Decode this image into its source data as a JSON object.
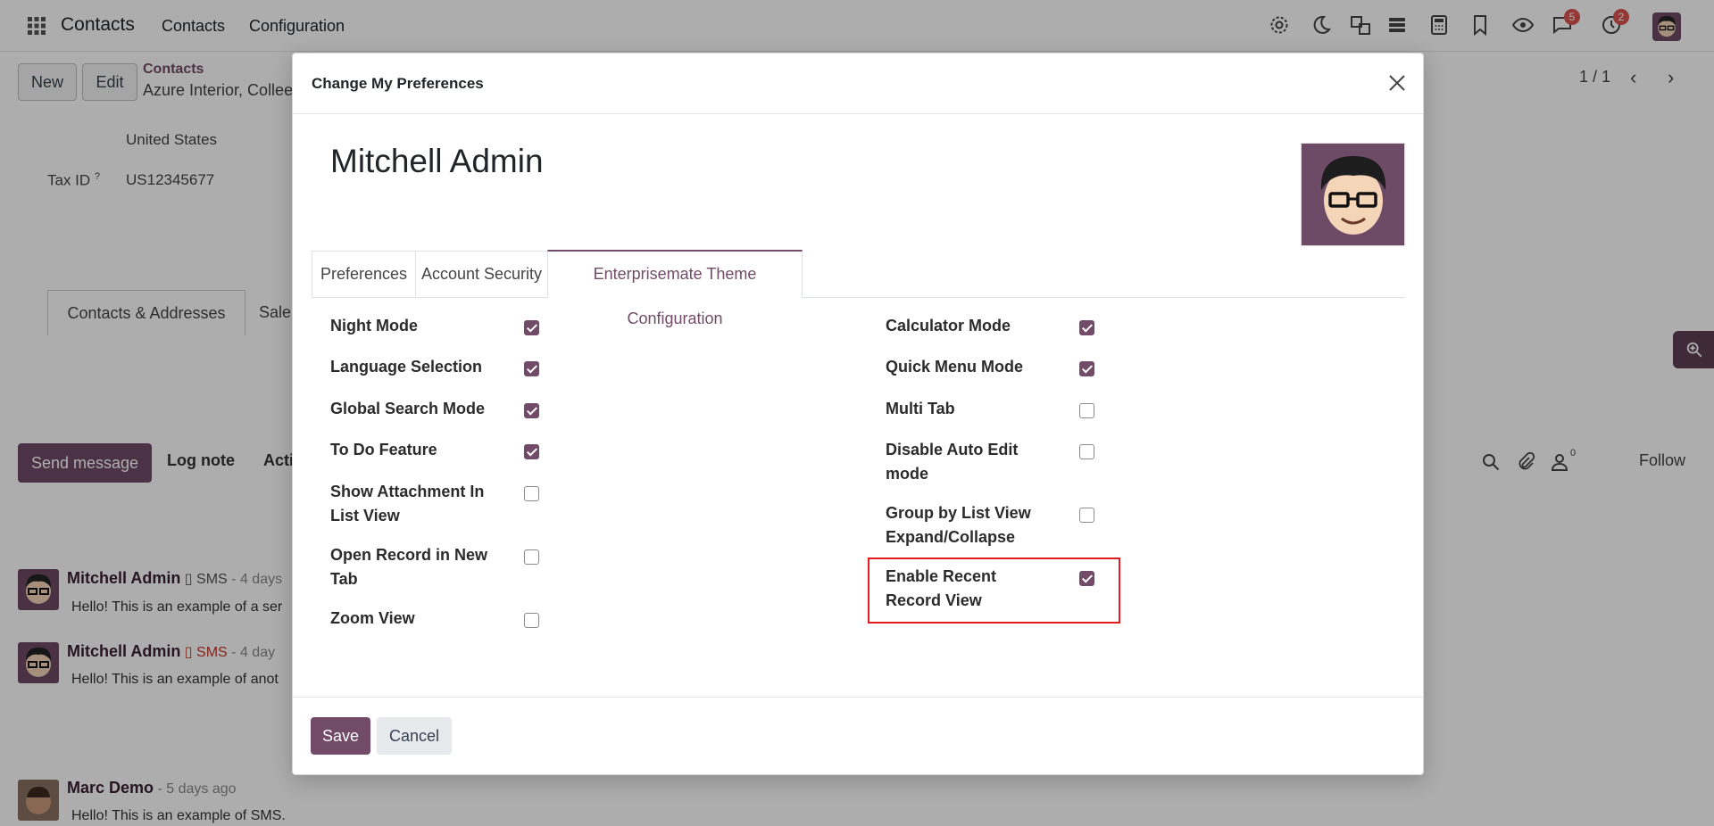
{
  "topbar": {
    "app_name": "Contacts",
    "menu": [
      "Contacts",
      "Configuration"
    ],
    "icons": [
      "gear-icon",
      "moon-icon",
      "translate-icon",
      "menu-icon",
      "calculator-icon",
      "bookmark-icon",
      "eye-icon",
      "chat-icon",
      "clock-icon"
    ],
    "messages_badge": "5",
    "activity_badge": "2"
  },
  "background": {
    "new_button": "New",
    "edit_button": "Edit",
    "breadcrumb": "Contacts",
    "record_title": "Azure Interior, Collee",
    "pager": "1 / 1",
    "country": "United States",
    "tax_label": "Tax ID",
    "tax_help": "?",
    "tax_value": "US12345677",
    "tab_contacts": "Contacts & Addresses",
    "tab_sales": "Sale",
    "send_message": "Send message",
    "log_note": "Log note",
    "activities": "Acti",
    "followers_count": "0",
    "follow": "Follow",
    "messages": [
      {
        "author": "Mitchell Admin",
        "type": "SMS",
        "time": "- 4 days",
        "body": "Hello! This is an example of a ser"
      },
      {
        "author": "Mitchell Admin",
        "type": "SMS",
        "time": "- 4 day",
        "body": "Hello! This is an example of anot"
      },
      {
        "author": "Marc Demo",
        "type": "",
        "time": "- 5 days ago",
        "body": "Hello! This is an example of SMS."
      }
    ]
  },
  "modal": {
    "title": "Change My Preferences",
    "user_name": "Mitchell Admin",
    "tabs": [
      "Preferences",
      "Account Security",
      "Enterprisemate Theme Configuration"
    ],
    "active_tab": "Enterprisemate Theme Configuration",
    "left_options": [
      {
        "label": "Night Mode",
        "checked": true
      },
      {
        "label": "Language Selection",
        "checked": true
      },
      {
        "label": "Global Search Mode",
        "checked": true
      },
      {
        "label": "To Do Feature",
        "checked": true
      },
      {
        "label": "Show Attachment In List View",
        "checked": false
      },
      {
        "label": "Open Record in New Tab",
        "checked": false
      },
      {
        "label": "Zoom View",
        "checked": false
      }
    ],
    "right_options": [
      {
        "label": "Calculator Mode",
        "checked": true
      },
      {
        "label": "Quick Menu Mode",
        "checked": true
      },
      {
        "label": "Multi Tab",
        "checked": false
      },
      {
        "label": "Disable Auto Edit mode",
        "checked": false
      },
      {
        "label": "Group by List View Expand/Collapse",
        "checked": false
      },
      {
        "label": "Enable Recent Record View",
        "checked": true
      }
    ],
    "save_label": "Save",
    "cancel_label": "Cancel",
    "colors": {
      "primary": "#714b67",
      "highlight": "#e31b23"
    }
  }
}
